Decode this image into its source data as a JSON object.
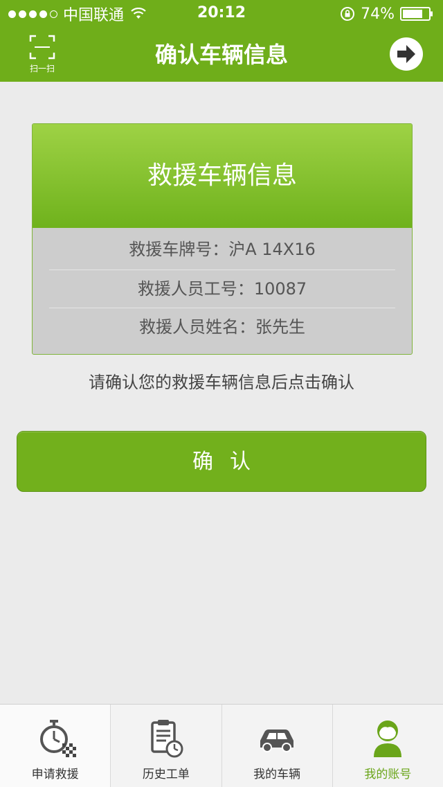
{
  "status_bar": {
    "carrier": "中国联通",
    "time": "20:12",
    "battery": "74%"
  },
  "nav": {
    "scan_label": "扫一扫",
    "title": "确认车辆信息"
  },
  "card": {
    "header": "救援车辆信息",
    "rows": [
      {
        "label": "救援车牌号：",
        "value": "沪A 14X16"
      },
      {
        "label": "救援人员工号：",
        "value": "10087"
      },
      {
        "label": "救援人员姓名：",
        "value": "张先生"
      }
    ]
  },
  "hint": "请确认您的救援车辆信息后点击确认",
  "confirm_label": "确认",
  "tabs": [
    {
      "label": "申请救援",
      "icon": "stopwatch-flag-icon"
    },
    {
      "label": "历史工单",
      "icon": "clipboard-clock-icon"
    },
    {
      "label": "我的车辆",
      "icon": "car-icon"
    },
    {
      "label": "我的账号",
      "icon": "user-icon"
    }
  ],
  "colors": {
    "brand_green": "#6fae1a",
    "active_tab": "#6aa51a"
  }
}
